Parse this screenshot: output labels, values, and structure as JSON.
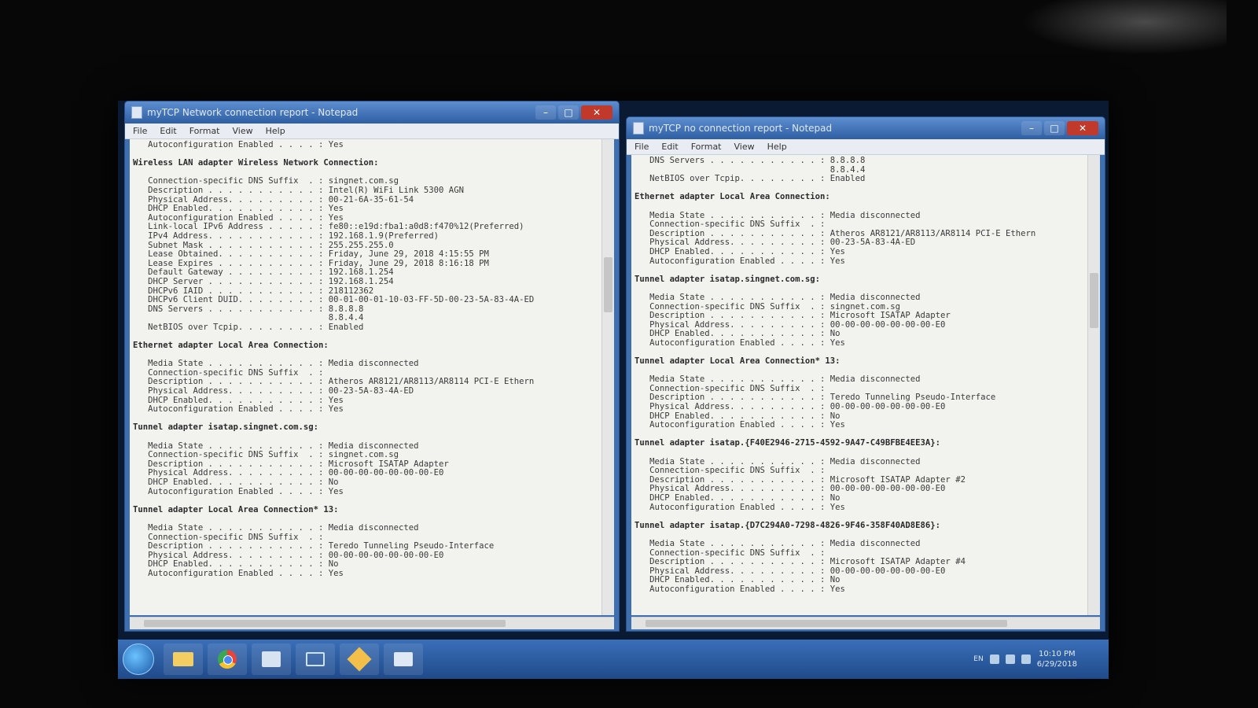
{
  "taskbar": {
    "lang": "EN",
    "clock_time": "10:10 PM",
    "clock_date": "6/29/2018",
    "items": [
      "start-button",
      "explorer",
      "chrome",
      "media",
      "network",
      "app",
      "notepad"
    ]
  },
  "left_window": {
    "title": "myTCP Network connection report - Notepad",
    "menu": [
      "File",
      "Edit",
      "Format",
      "View",
      "Help"
    ],
    "lines": [
      "   Autoconfiguration Enabled . . . . : Yes",
      "",
      "Wireless LAN adapter Wireless Network Connection:",
      "",
      "   Connection-specific DNS Suffix  . : singnet.com.sg",
      "   Description . . . . . . . . . . . : Intel(R) WiFi Link 5300 AGN",
      "   Physical Address. . . . . . . . . : 00-21-6A-35-61-54",
      "   DHCP Enabled. . . . . . . . . . . : Yes",
      "   Autoconfiguration Enabled . . . . : Yes",
      "   Link-local IPv6 Address . . . . . : fe80::e19d:fba1:a0d8:f470%12(Preferred)",
      "   IPv4 Address. . . . . . . . . . . : 192.168.1.9(Preferred)",
      "   Subnet Mask . . . . . . . . . . . : 255.255.255.0",
      "   Lease Obtained. . . . . . . . . . : Friday, June 29, 2018 4:15:55 PM",
      "   Lease Expires . . . . . . . . . . : Friday, June 29, 2018 8:16:18 PM",
      "   Default Gateway . . . . . . . . . : 192.168.1.254",
      "   DHCP Server . . . . . . . . . . . : 192.168.1.254",
      "   DHCPv6 IAID . . . . . . . . . . . : 218112362",
      "   DHCPv6 Client DUID. . . . . . . . : 00-01-00-01-10-03-FF-5D-00-23-5A-83-4A-ED",
      "   DNS Servers . . . . . . . . . . . : 8.8.8.8",
      "                                       8.8.4.4",
      "   NetBIOS over Tcpip. . . . . . . . : Enabled",
      "",
      "Ethernet adapter Local Area Connection:",
      "",
      "   Media State . . . . . . . . . . . : Media disconnected",
      "   Connection-specific DNS Suffix  . :",
      "   Description . . . . . . . . . . . : Atheros AR8121/AR8113/AR8114 PCI-E Ethern",
      "   Physical Address. . . . . . . . . : 00-23-5A-83-4A-ED",
      "   DHCP Enabled. . . . . . . . . . . : Yes",
      "   Autoconfiguration Enabled . . . . : Yes",
      "",
      "Tunnel adapter isatap.singnet.com.sg:",
      "",
      "   Media State . . . . . . . . . . . : Media disconnected",
      "   Connection-specific DNS Suffix  . : singnet.com.sg",
      "   Description . . . . . . . . . . . : Microsoft ISATAP Adapter",
      "   Physical Address. . . . . . . . . : 00-00-00-00-00-00-00-E0",
      "   DHCP Enabled. . . . . . . . . . . : No",
      "   Autoconfiguration Enabled . . . . : Yes",
      "",
      "Tunnel adapter Local Area Connection* 13:",
      "",
      "   Media State . . . . . . . . . . . : Media disconnected",
      "   Connection-specific DNS Suffix  . :",
      "   Description . . . . . . . . . . . : Teredo Tunneling Pseudo-Interface",
      "   Physical Address. . . . . . . . . : 00-00-00-00-00-00-00-E0",
      "   DHCP Enabled. . . . . . . . . . . : No",
      "   Autoconfiguration Enabled . . . . : Yes"
    ]
  },
  "right_window": {
    "title": "myTCP no connection report - Notepad",
    "menu": [
      "File",
      "Edit",
      "Format",
      "View",
      "Help"
    ],
    "lines": [
      "   DNS Servers . . . . . . . . . . . : 8.8.8.8",
      "                                       8.8.4.4",
      "   NetBIOS over Tcpip. . . . . . . . : Enabled",
      "",
      "Ethernet adapter Local Area Connection:",
      "",
      "   Media State . . . . . . . . . . . : Media disconnected",
      "   Connection-specific DNS Suffix  . :",
      "   Description . . . . . . . . . . . : Atheros AR8121/AR8113/AR8114 PCI-E Ethern",
      "   Physical Address. . . . . . . . . : 00-23-5A-83-4A-ED",
      "   DHCP Enabled. . . . . . . . . . . : Yes",
      "   Autoconfiguration Enabled . . . . : Yes",
      "",
      "Tunnel adapter isatap.singnet.com.sg:",
      "",
      "   Media State . . . . . . . . . . . : Media disconnected",
      "   Connection-specific DNS Suffix  . : singnet.com.sg",
      "   Description . . . . . . . . . . . : Microsoft ISATAP Adapter",
      "   Physical Address. . . . . . . . . : 00-00-00-00-00-00-00-E0",
      "   DHCP Enabled. . . . . . . . . . . : No",
      "   Autoconfiguration Enabled . . . . : Yes",
      "",
      "Tunnel adapter Local Area Connection* 13:",
      "",
      "   Media State . . . . . . . . . . . : Media disconnected",
      "   Connection-specific DNS Suffix  . :",
      "   Description . . . . . . . . . . . : Teredo Tunneling Pseudo-Interface",
      "   Physical Address. . . . . . . . . : 00-00-00-00-00-00-00-E0",
      "   DHCP Enabled. . . . . . . . . . . : No",
      "   Autoconfiguration Enabled . . . . : Yes",
      "",
      "Tunnel adapter isatap.{F40E2946-2715-4592-9A47-C49BFBE4EE3A}:",
      "",
      "   Media State . . . . . . . . . . . : Media disconnected",
      "   Connection-specific DNS Suffix  . :",
      "   Description . . . . . . . . . . . : Microsoft ISATAP Adapter #2",
      "   Physical Address. . . . . . . . . : 00-00-00-00-00-00-00-E0",
      "   DHCP Enabled. . . . . . . . . . . : No",
      "   Autoconfiguration Enabled . . . . : Yes",
      "",
      "Tunnel adapter isatap.{D7C294A0-7298-4826-9F46-358F40AD8E86}:",
      "",
      "   Media State . . . . . . . . . . . : Media disconnected",
      "   Connection-specific DNS Suffix  . :",
      "   Description . . . . . . . . . . . : Microsoft ISATAP Adapter #4",
      "   Physical Address. . . . . . . . . : 00-00-00-00-00-00-00-E0",
      "   DHCP Enabled. . . . . . . . . . . : No",
      "   Autoconfiguration Enabled . . . . : Yes"
    ]
  }
}
